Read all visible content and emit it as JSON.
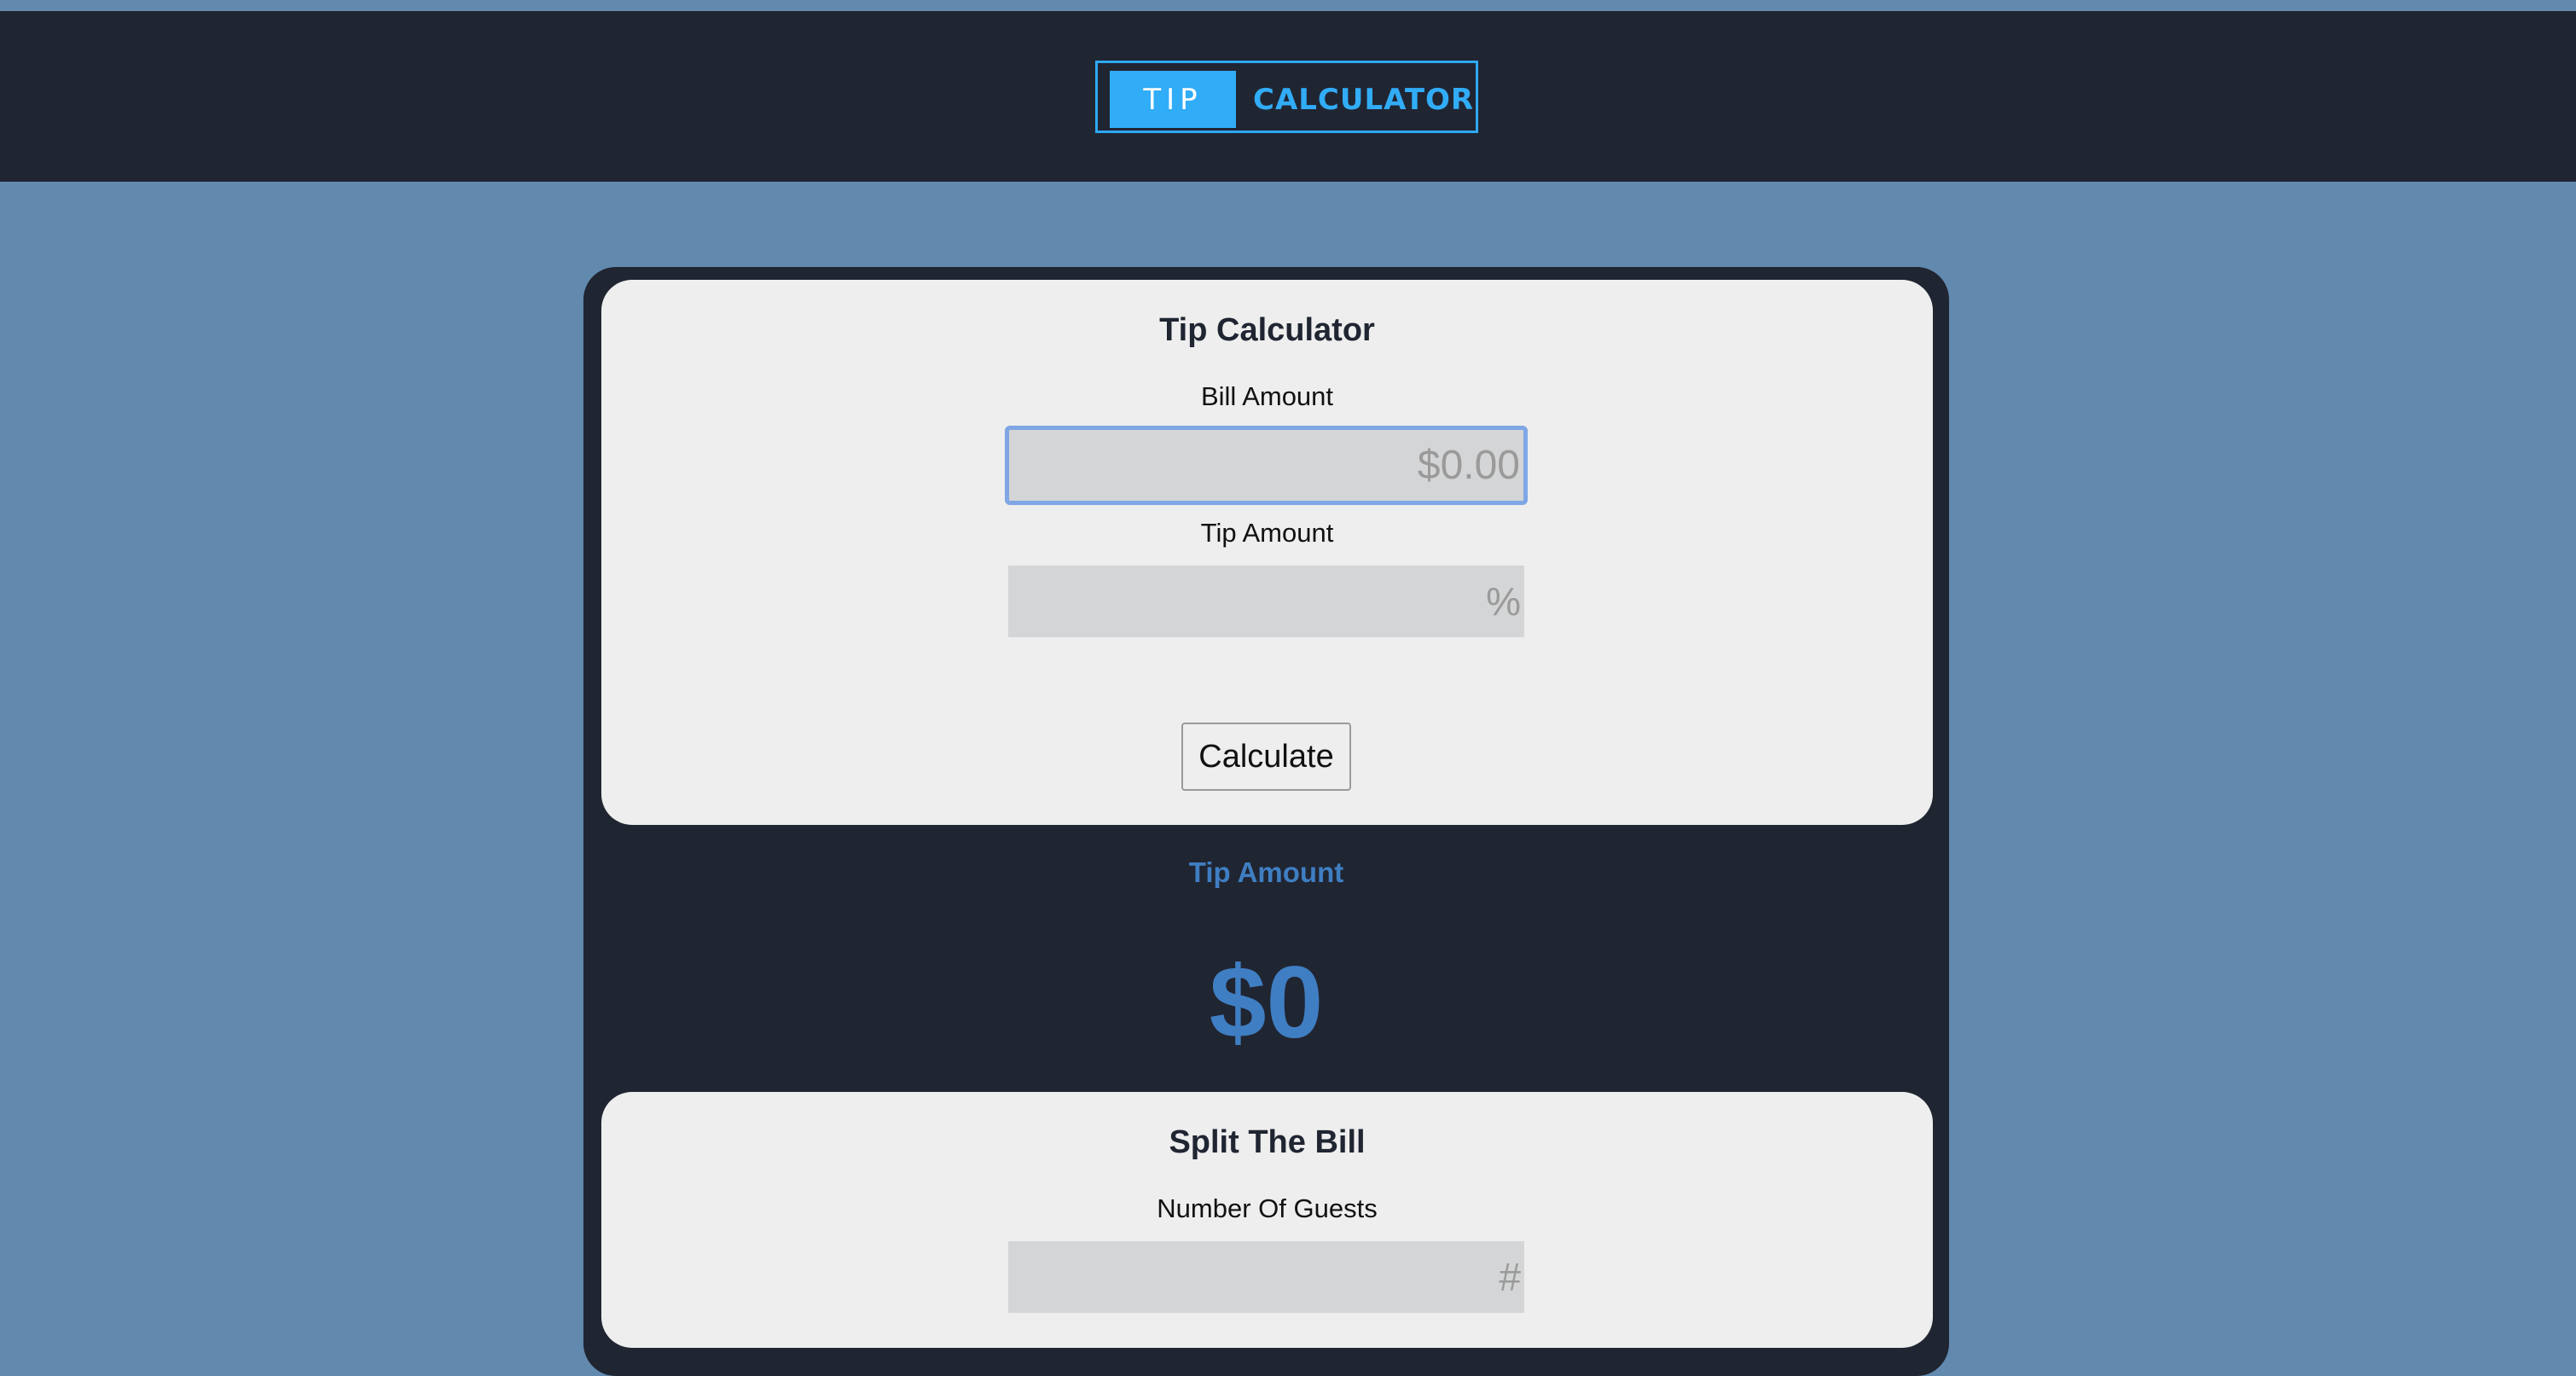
{
  "header": {
    "logo_tip": "TIP",
    "logo_calculator": "CALCULATOR"
  },
  "tip_card": {
    "title": "Tip Calculator",
    "bill_label": "Bill Amount",
    "bill_placeholder": "$0.00",
    "bill_value": "",
    "tip_label": "Tip Amount",
    "tip_placeholder": "%",
    "tip_value": "",
    "calculate_button": "Calculate"
  },
  "result": {
    "label": "Tip Amount",
    "value": "$0"
  },
  "split_card": {
    "title": "Split The Bill",
    "guests_label": "Number Of Guests",
    "guests_placeholder": "#",
    "guests_value": ""
  },
  "colors": {
    "background": "#6289ae",
    "header": "#202532",
    "accent": "#31acf6",
    "result": "#3f7ec2",
    "card": "#eeeeee",
    "input": "#d4d5d6",
    "focus_ring": "#7fa6e5"
  }
}
